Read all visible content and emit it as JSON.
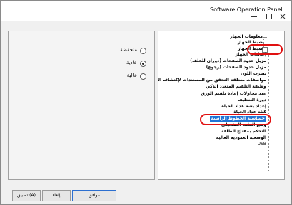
{
  "window": {
    "title": "Software Operation Panel",
    "close_symbol": "×"
  },
  "radios": [
    {
      "label": "منخفضة",
      "selected": false
    },
    {
      "label": "عادية",
      "selected": true
    },
    {
      "label": "عالية",
      "selected": false
    }
  ],
  "tree": {
    "items": [
      "معلومات الجهاز",
      "ضبط الجهاز",
      "ضبط الجهاز",
      "إعدادات الجهاز",
      "مزيل حدود الصفحات (دوران للخلف)",
      "مزيل حدود الصفحات (رجوع)",
      "تسرب اللون",
      "مواصفات منطقة التحقق من المستندات لإكتشاف التلقيم المتعدد",
      "وظيفة التلقيم المتعدد الذكي",
      "عدد محاولات إعادة تلقيم الورق",
      "دورة التنظيف",
      "إعداد بشة عداد الحياة",
      "كتلة عداد الحياة",
      "حساسية الخطوط الرأسية",
      "وضع الملف التشغيلي",
      "التحكم بمفتاح الطاقة",
      "الوضعية العمودية العالية",
      "USB"
    ],
    "selected_item": "حساسية الخطوط الرأسية",
    "expander": "⊟"
  },
  "buttons": {
    "ok": "موافق",
    "cancel": "إلغاء",
    "apply": "تطبيق (A)"
  }
}
